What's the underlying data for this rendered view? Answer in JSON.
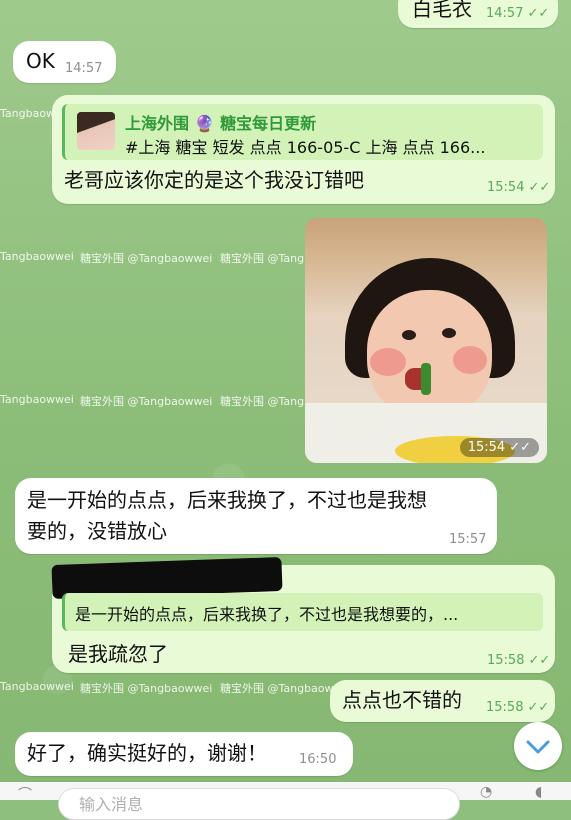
{
  "watermark": "糖宝外围 @Tangbaowwei",
  "messages": {
    "m1": {
      "text": "白毛衣",
      "time": "14:57",
      "checks": "✓✓"
    },
    "m2": {
      "text": "OK",
      "time": "14:57"
    },
    "m3": {
      "reply_title": "上海外围 🔮 糖宝每日更新",
      "reply_text": "#上海 糖宝 短发 点点 166-05-C 上海 点点 166...",
      "text": "老哥应该你定的是这个我没订错吧",
      "time": "15:54",
      "checks": "✓✓"
    },
    "m4": {
      "time": "15:54",
      "checks": "✓✓"
    },
    "m5": {
      "line1": "是一开始的点点，后来我换了，不过也是我想",
      "line2": "要的，没错放心",
      "time": "15:57"
    },
    "m6": {
      "reply_text": "是一开始的点点，后来我换了，不过也是我想要的，...",
      "text": "是我疏忽了",
      "time": "15:58",
      "checks": "✓✓"
    },
    "m7": {
      "text": "点点也不错的",
      "time": "15:58",
      "checks": "✓✓"
    },
    "m8": {
      "text": "好了，确实挺好的，谢谢！",
      "time": "16:50"
    }
  },
  "input": {
    "placeholder": "输入消息"
  },
  "colors": {
    "accent": "#5aa85a",
    "outgoing": "#e9fbd6",
    "incoming": "#ffffff"
  },
  "icons": {
    "scroll_down": "chevron-down-icon",
    "read": "double-check-icon"
  }
}
